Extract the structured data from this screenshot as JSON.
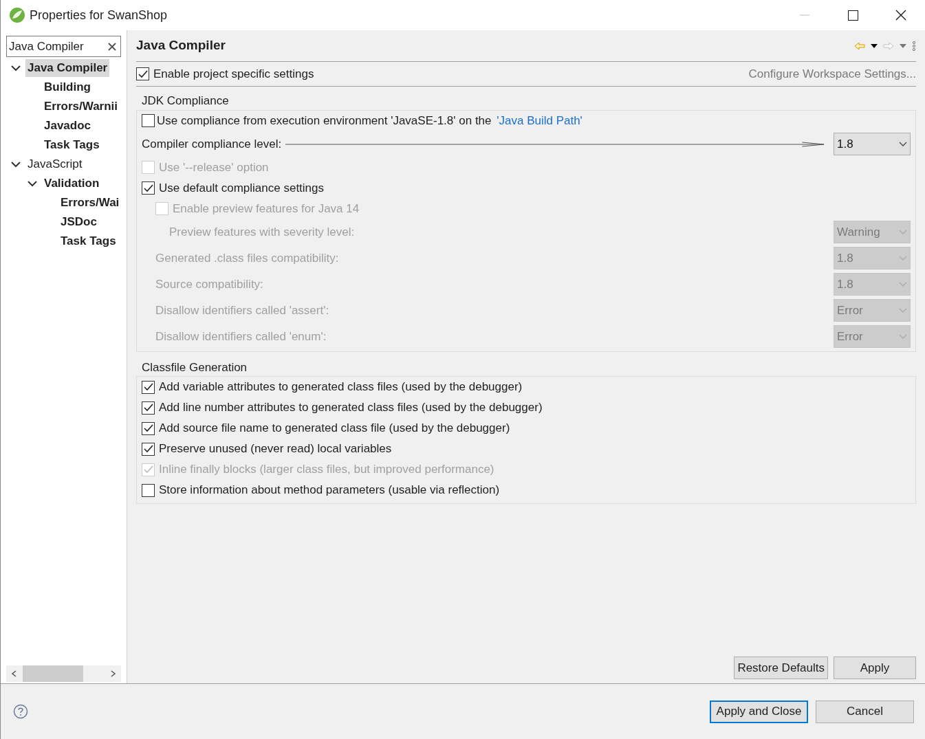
{
  "window": {
    "title": "Properties for SwanShop"
  },
  "filter": {
    "value": "Java Compiler"
  },
  "tree": [
    {
      "label": "Java Compiler",
      "matched": true,
      "selected": true,
      "expanded": true,
      "children": [
        {
          "label": "Building",
          "matched": true,
          "selected": false
        },
        {
          "label": "Errors/Warnii",
          "matched": true,
          "selected": false
        },
        {
          "label": "Javadoc",
          "matched": true,
          "selected": false
        },
        {
          "label": "Task Tags",
          "matched": true,
          "selected": false
        }
      ]
    },
    {
      "label": "JavaScript",
      "matched": false,
      "selected": false,
      "expanded": true,
      "children": [
        {
          "label": "Validation",
          "matched": true,
          "selected": false,
          "expanded": true,
          "children": [
            {
              "label": "Errors/Wai",
              "matched": true,
              "selected": false
            },
            {
              "label": "JSDoc",
              "matched": true,
              "selected": false
            },
            {
              "label": "Task Tags",
              "matched": true,
              "selected": false
            }
          ]
        }
      ]
    }
  ],
  "page": {
    "title": "Java Compiler",
    "project_specific": {
      "label": "Enable project specific settings",
      "checked": true
    },
    "workspace_link": "Configure Workspace Settings...",
    "jdk": {
      "title": "JDK Compliance",
      "rows": [
        {
          "kind": "link-checkbox",
          "label": "Use compliance from execution environment 'JavaSE-1.8' on the ",
          "link": "'Java Build Path'",
          "checked": false,
          "disabled": false
        },
        {
          "kind": "leader-combo",
          "label": "Compiler compliance level:",
          "value": "1.8",
          "disabled": false
        },
        {
          "kind": "checkbox",
          "label": "Use '--release' option",
          "checked": false,
          "disabled": true
        },
        {
          "kind": "checkbox",
          "label": "Use default compliance settings",
          "checked": true,
          "disabled": false,
          "children": [
            {
              "kind": "checkbox",
              "label": "Enable preview features for Java 14",
              "checked": false,
              "disabled": true,
              "children": [
                {
                  "kind": "combo",
                  "label": "Preview features with severity level:",
                  "value": "Warning",
                  "disabled": true
                }
              ]
            },
            {
              "kind": "combo",
              "label": "Generated .class files compatibility:",
              "value": "1.8",
              "disabled": true
            },
            {
              "kind": "combo",
              "label": "Source compatibility:",
              "value": "1.8",
              "disabled": true
            },
            {
              "kind": "combo",
              "label": "Disallow identifiers called 'assert':",
              "value": "Error",
              "disabled": true
            },
            {
              "kind": "combo",
              "label": "Disallow identifiers called 'enum':",
              "value": "Error",
              "disabled": true
            }
          ]
        }
      ]
    },
    "classfile": {
      "title": "Classfile Generation",
      "rows": [
        {
          "label": "Add variable attributes to generated class files (used by the debugger)",
          "checked": true,
          "disabled": false
        },
        {
          "label": "Add line number attributes to generated class files (used by the debugger)",
          "checked": true,
          "disabled": false
        },
        {
          "label": "Add source file name to generated class file (used by the debugger)",
          "checked": true,
          "disabled": false
        },
        {
          "label": "Preserve unused (never read) local variables",
          "checked": true,
          "disabled": false
        },
        {
          "label": "Inline finally blocks (larger class files, but improved performance)",
          "checked": true,
          "disabled": true
        },
        {
          "label": "Store information about method parameters (usable via reflection)",
          "checked": false,
          "disabled": false
        }
      ]
    },
    "buttons": [
      "Restore Defaults",
      "Apply"
    ]
  },
  "footer": {
    "buttons": [
      {
        "label": "Apply and Close",
        "default": true
      },
      {
        "label": "Cancel",
        "default": false
      }
    ]
  }
}
